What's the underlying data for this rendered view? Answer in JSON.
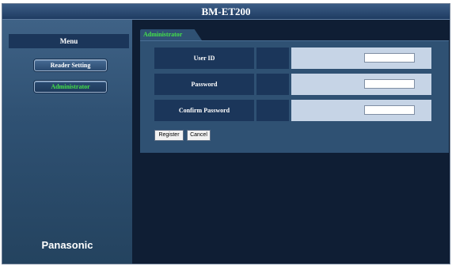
{
  "window": {
    "title": "BM-ET200"
  },
  "sidebar": {
    "menu_header": "Menu",
    "items": [
      {
        "label": "Reader Setting"
      },
      {
        "label": "Administrator",
        "selected": true
      }
    ],
    "brand": "Panasonic"
  },
  "main": {
    "tab_label": "Administrator",
    "fields": [
      {
        "label": "User ID",
        "value": ""
      },
      {
        "label": "Password",
        "value": ""
      },
      {
        "label": "Confirm Password",
        "value": ""
      }
    ],
    "buttons": {
      "register": "Register",
      "cancel": "Cancel"
    }
  },
  "colors": {
    "accent_text": "#44e04a",
    "title_bar": "#2b4c74",
    "panel": "#2f5173",
    "background": "#0f1e34"
  }
}
